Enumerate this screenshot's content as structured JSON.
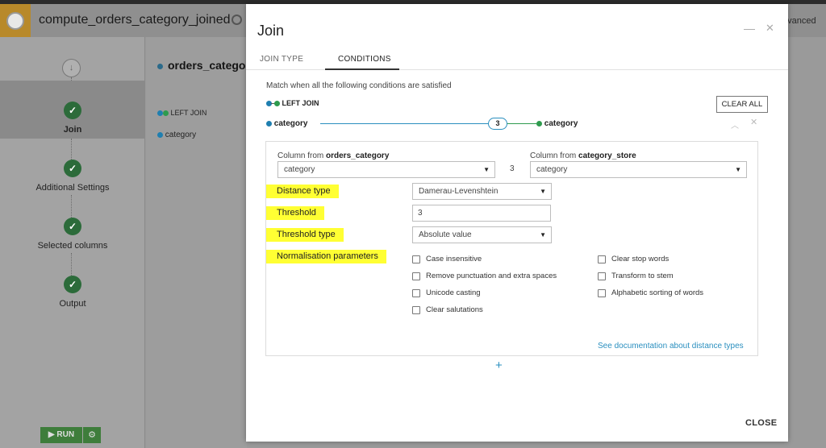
{
  "app": {
    "recipe_title": "compute_orders_category_joined",
    "advanced_label": "dvanced"
  },
  "steps": [
    {
      "label": "Join"
    },
    {
      "label": "Additional Settings"
    },
    {
      "label": "Selected columns"
    },
    {
      "label": "Output"
    }
  ],
  "start_icon": "↓",
  "run": {
    "label": "RUN"
  },
  "background": {
    "dataset_name": "orders_categor",
    "join_label": "LEFT JOIN",
    "column": "category"
  },
  "modal": {
    "title": "Join",
    "tabs": [
      {
        "label": "JOIN TYPE",
        "active": false
      },
      {
        "label": "CONDITIONS",
        "active": true
      }
    ],
    "description": "Match when all the following conditions are satisfied",
    "join_type": "LEFT JOIN",
    "clear_all": "CLEAR ALL",
    "condition": {
      "left_column": "category",
      "right_column": "category",
      "threshold_badge": "3"
    },
    "panel": {
      "left_from_prefix": "Column from ",
      "left_dataset": "orders_category",
      "right_from_prefix": "Column from ",
      "right_dataset": "category_store",
      "left_select": "category",
      "right_select": "category",
      "middle_value": "3",
      "params": {
        "distance_type_label": "Distance type",
        "distance_type_value": "Damerau-Levenshtein",
        "threshold_label": "Threshold",
        "threshold_value": "3",
        "threshold_type_label": "Threshold type",
        "threshold_type_value": "Absolute value",
        "normalisation_label": "Normalisation parameters"
      },
      "options_left": [
        {
          "label": "Case insensitive",
          "checked": false
        },
        {
          "label": "Remove punctuation and extra spaces",
          "checked": false
        },
        {
          "label": "Unicode casting",
          "checked": false
        },
        {
          "label": "Clear salutations",
          "checked": false
        }
      ],
      "options_right": [
        {
          "label": "Clear stop words",
          "checked": false
        },
        {
          "label": "Transform to stem",
          "checked": false
        },
        {
          "label": "Alphabetic sorting of words",
          "checked": false
        }
      ],
      "doc_link": "See documentation about distance types"
    },
    "add_condition": "+",
    "close_label": "CLOSE"
  },
  "colors": {
    "accent": "#2a8fbf",
    "success": "#2e9b4e",
    "highlight": "#ffff33"
  }
}
